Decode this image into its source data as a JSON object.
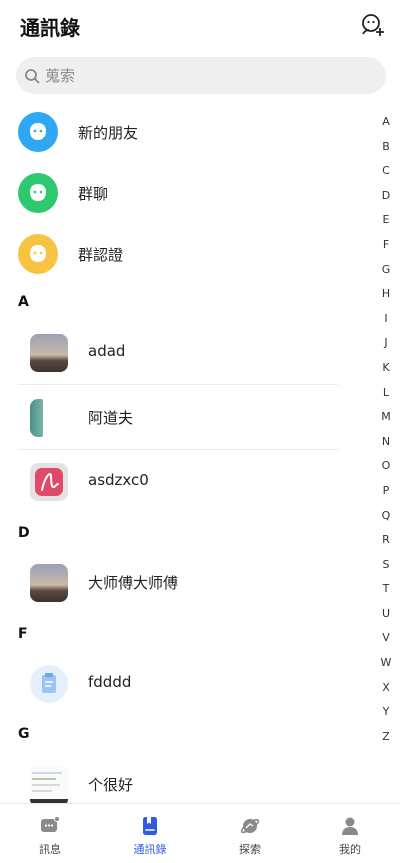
{
  "header": {
    "title": "通訊錄"
  },
  "search": {
    "placeholder": "蒐索"
  },
  "quick_items": [
    {
      "label": "新的朋友",
      "color": "#2fa7f5"
    },
    {
      "label": "群聊",
      "color": "#2cc96e"
    },
    {
      "label": "群認證",
      "color": "#f7c340"
    }
  ],
  "sections": [
    {
      "letter": "A",
      "contacts": [
        {
          "name": "adad"
        },
        {
          "name": "阿道夫"
        },
        {
          "name": "asdzxc0"
        }
      ]
    },
    {
      "letter": "D",
      "contacts": [
        {
          "name": "大师傅大师傅"
        }
      ]
    },
    {
      "letter": "F",
      "contacts": [
        {
          "name": "fdddd"
        }
      ]
    },
    {
      "letter": "G",
      "contacts": [
        {
          "name": "个很好"
        }
      ]
    }
  ],
  "index_letters": [
    "A",
    "B",
    "C",
    "D",
    "E",
    "F",
    "G",
    "H",
    "I",
    "J",
    "K",
    "L",
    "M",
    "N",
    "O",
    "P",
    "Q",
    "R",
    "S",
    "T",
    "U",
    "V",
    "W",
    "X",
    "Y",
    "Z"
  ],
  "tabs": [
    {
      "label": "訊息",
      "active": false
    },
    {
      "label": "通訊錄",
      "active": true
    },
    {
      "label": "探索",
      "active": false
    },
    {
      "label": "我的",
      "active": false
    }
  ],
  "colors": {
    "accent": "#2f5be5",
    "search_bg": "#efefef"
  }
}
